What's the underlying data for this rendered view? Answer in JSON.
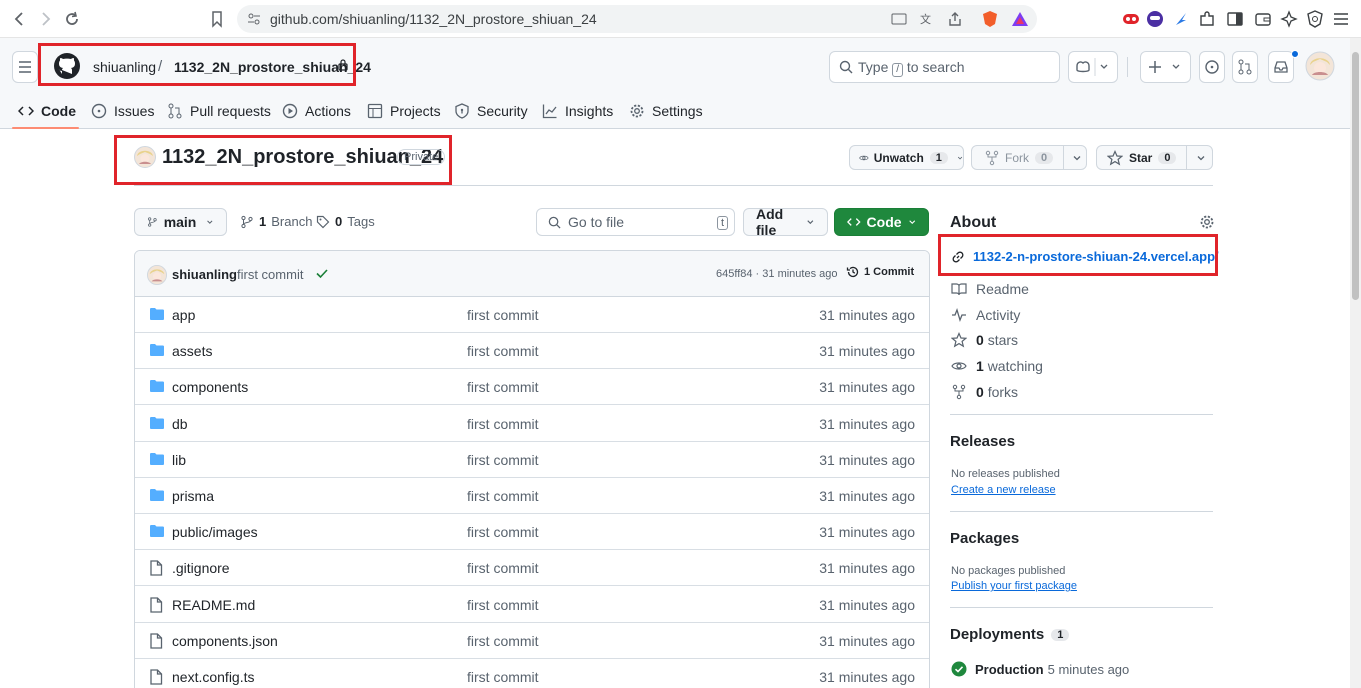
{
  "browser": {
    "url": "github.com/shiuanling/1132_2N_prostore_shiuan_24"
  },
  "header": {
    "owner": "shiuanling",
    "separator": "/",
    "repo": "1132_2N_prostore_shiuan_24",
    "search_placeholder_pre": "Type",
    "search_key": "/",
    "search_placeholder_post": "to search"
  },
  "tabs": [
    {
      "label": "Code"
    },
    {
      "label": "Issues"
    },
    {
      "label": "Pull requests"
    },
    {
      "label": "Actions"
    },
    {
      "label": "Projects"
    },
    {
      "label": "Security"
    },
    {
      "label": "Insights"
    },
    {
      "label": "Settings"
    }
  ],
  "repo": {
    "title": "1132_2N_prostore_shiuan_24",
    "visibility": "Private",
    "unwatch_label": "Unwatch",
    "unwatch_count": "1",
    "fork_label": "Fork",
    "fork_count": "0",
    "star_label": "Star",
    "star_count": "0"
  },
  "toolbar": {
    "branch": "main",
    "branches_count": "1",
    "branches_label": "Branch",
    "tags_count": "0",
    "tags_label": "Tags",
    "goto_placeholder": "Go to file",
    "goto_key": "t",
    "add_file": "Add file",
    "code": "Code"
  },
  "commit": {
    "author": "shiuanling",
    "message": "first commit",
    "hash_time": "645ff84 · 31 minutes ago",
    "commits": "1 Commit"
  },
  "files": [
    {
      "name": "app",
      "type": "folder",
      "message": "first commit",
      "time": "31 minutes ago"
    },
    {
      "name": "assets",
      "type": "folder",
      "message": "first commit",
      "time": "31 minutes ago"
    },
    {
      "name": "components",
      "type": "folder",
      "message": "first commit",
      "time": "31 minutes ago"
    },
    {
      "name": "db",
      "type": "folder",
      "message": "first commit",
      "time": "31 minutes ago"
    },
    {
      "name": "lib",
      "type": "folder",
      "message": "first commit",
      "time": "31 minutes ago"
    },
    {
      "name": "prisma",
      "type": "folder",
      "message": "first commit",
      "time": "31 minutes ago"
    },
    {
      "name": "public/images",
      "type": "folder",
      "message": "first commit",
      "time": "31 minutes ago"
    },
    {
      "name": ".gitignore",
      "type": "file",
      "message": "first commit",
      "time": "31 minutes ago"
    },
    {
      "name": "README.md",
      "type": "file",
      "message": "first commit",
      "time": "31 minutes ago"
    },
    {
      "name": "components.json",
      "type": "file",
      "message": "first commit",
      "time": "31 minutes ago"
    },
    {
      "name": "next.config.ts",
      "type": "file",
      "message": "first commit",
      "time": "31 minutes ago"
    }
  ],
  "about": {
    "heading": "About",
    "website": "1132-2-n-prostore-shiuan-24.vercel.app/",
    "readme": "Readme",
    "activity": "Activity",
    "stars_count": "0",
    "stars_label": "stars",
    "watching_count": "1",
    "watching_label": "watching",
    "forks_count": "0",
    "forks_label": "forks"
  },
  "releases": {
    "heading": "Releases",
    "note": "No releases published",
    "link": "Create a new release"
  },
  "packages": {
    "heading": "Packages",
    "note": "No packages published",
    "link": "Publish your first package"
  },
  "deployments": {
    "heading": "Deployments",
    "count": "1",
    "env": "Production",
    "time": "5 minutes ago"
  },
  "colors": {
    "highlight_box": "#e0242a",
    "primary_green": "#1f883d",
    "link_blue": "#0969da",
    "folder_blue": "#54aeff"
  }
}
